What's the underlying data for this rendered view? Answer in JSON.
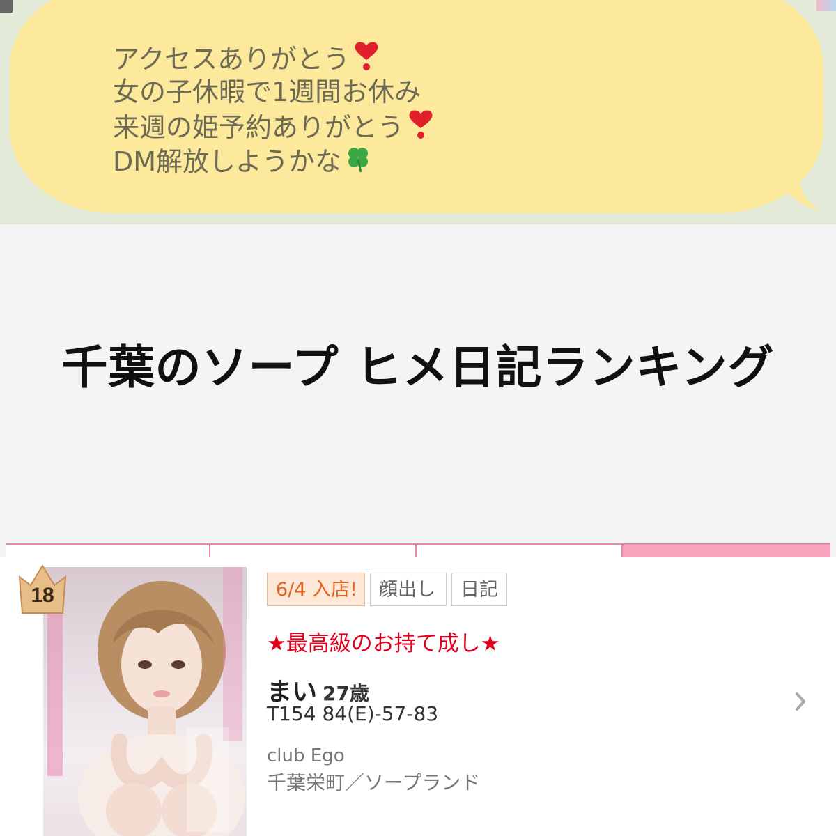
{
  "bubble": {
    "lines": [
      {
        "text": "アクセスありがとう",
        "emoji": "heart-exclamation-icon"
      },
      {
        "text": "女の子休暇で1週間お休み",
        "emoji": ""
      },
      {
        "text": "来週の姫予約ありがとう",
        "emoji": "heart-exclamation-icon"
      },
      {
        "text": "DM解放しようかな",
        "emoji": "clover-icon"
      }
    ]
  },
  "page": {
    "title": "千葉のソープ ヒメ日記ランキング"
  },
  "tabs": {
    "count": 4,
    "active_index": 3
  },
  "card": {
    "rank": "18",
    "badges": [
      "6/4 入店!",
      "顔出し",
      "日記"
    ],
    "catch_copy": "★最高級のお持て成し★",
    "name": "まい",
    "age": "27歳",
    "spec": "T154 84(E)-57-83",
    "shop": "club Ego",
    "area": "千葉栄町／ソープランド"
  },
  "colors": {
    "bubble": "#fde99b",
    "bubble_text": "#6d6a55",
    "accent_pink": "#e88aa3",
    "catch_red": "#e2001c",
    "badge_orange": "#e0611e"
  }
}
